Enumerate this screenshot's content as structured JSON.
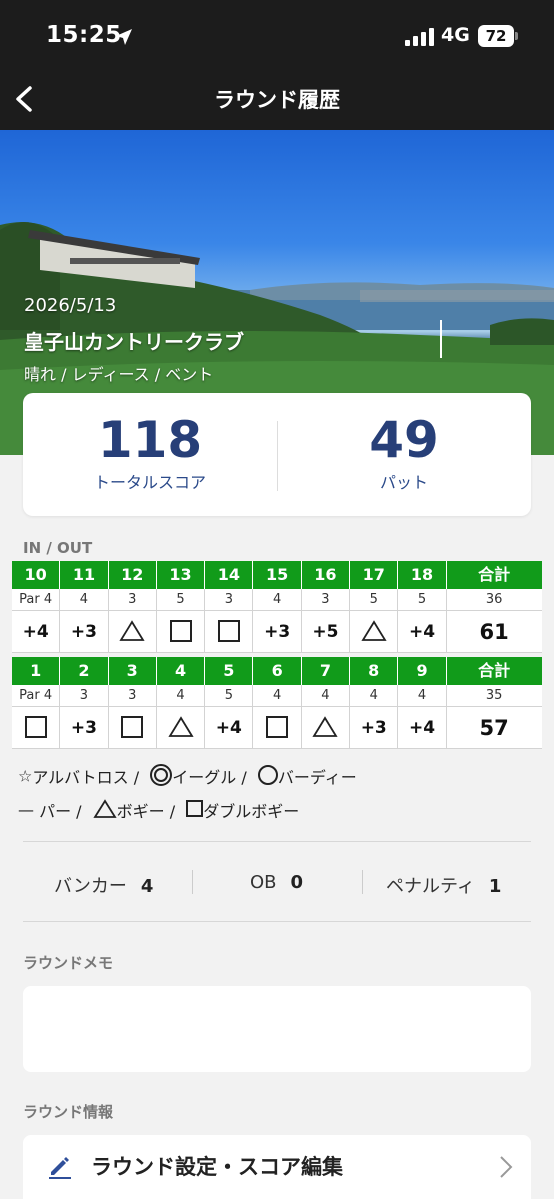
{
  "status_bar": {
    "time": "15:25",
    "network": "4G",
    "battery": "72"
  },
  "nav": {
    "title": "ラウンド履歴"
  },
  "hero": {
    "date": "2026/5/13",
    "course": "皇子山カントリークラブ",
    "conditions": "晴れ / レディース  / ベント"
  },
  "summary": {
    "total_score": "118",
    "total_score_label": "トータルスコア",
    "putts": "49",
    "putts_label": "パット"
  },
  "scorecard": {
    "section_label": "IN / OUT",
    "total_label": "合計",
    "in": {
      "holes": [
        "10",
        "11",
        "12",
        "13",
        "14",
        "15",
        "16",
        "17",
        "18"
      ],
      "pars": [
        "Par 4",
        "4",
        "3",
        "5",
        "3",
        "4",
        "3",
        "5",
        "5"
      ],
      "par_total": "36",
      "results": [
        "+4",
        "+3",
        "triangle",
        "square",
        "square",
        "+3",
        "+5",
        "triangle",
        "+4"
      ],
      "score_total": "61"
    },
    "out": {
      "holes": [
        "1",
        "2",
        "3",
        "4",
        "5",
        "6",
        "7",
        "8",
        "9"
      ],
      "pars": [
        "Par 4",
        "3",
        "3",
        "4",
        "5",
        "4",
        "4",
        "4",
        "4"
      ],
      "par_total": "35",
      "results": [
        "square",
        "+3",
        "square",
        "triangle",
        "+4",
        "square",
        "triangle",
        "+3",
        "+4"
      ],
      "score_total": "57"
    }
  },
  "legend": {
    "albatross": "アルバトロス /",
    "eagle": "イーグル /",
    "birdie": "バーディー",
    "par": "パー /",
    "bogey": "ボギー /",
    "double_bogey": "ダブルボギー"
  },
  "stats": {
    "bunker_label": "バンカー",
    "bunker": "4",
    "ob_label": "OB",
    "ob": "0",
    "penalty_label": "ペナルティ",
    "penalty": "1"
  },
  "memo": {
    "label": "ラウンドメモ",
    "value": ""
  },
  "round_info": {
    "label": "ラウンド情報",
    "edit_label": "ラウンド設定・スコア編集"
  },
  "colors": {
    "header_bg": "#1c1c1c",
    "accent_green": "#119b1a",
    "score_blue": "#273f78"
  }
}
